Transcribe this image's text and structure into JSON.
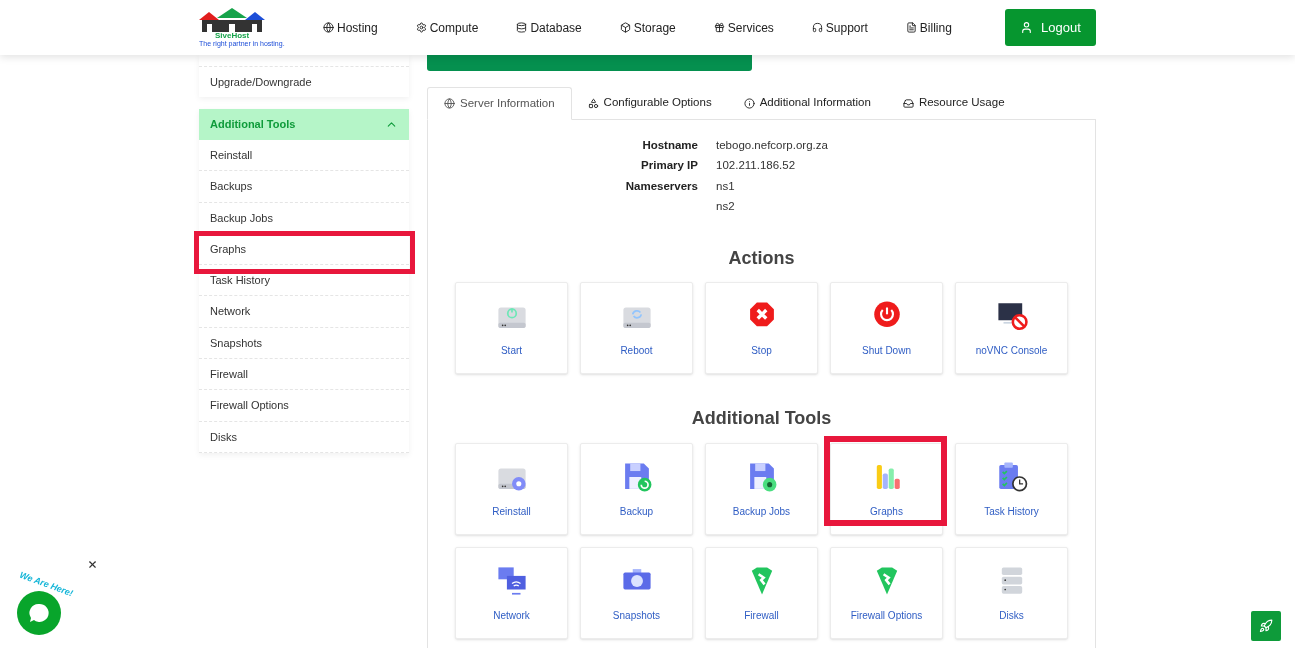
{
  "logo": {
    "name": "SiveHost",
    "tagline": "The right partner in hosting."
  },
  "nav": [
    {
      "label": "Hosting"
    },
    {
      "label": "Compute"
    },
    {
      "label": "Database"
    },
    {
      "label": "Storage"
    },
    {
      "label": "Services"
    },
    {
      "label": "Support"
    },
    {
      "label": "Billing"
    }
  ],
  "logout": "Logout",
  "sidebar": {
    "top_items": [
      {
        "label": "Upgrade/Downgrade"
      }
    ],
    "section": {
      "title": "Additional Tools",
      "expanded": true,
      "items": [
        {
          "label": "Reinstall",
          "highlighted": false
        },
        {
          "label": "Backups",
          "highlighted": false
        },
        {
          "label": "Backup Jobs",
          "highlighted": false
        },
        {
          "label": "Graphs",
          "highlighted": true
        },
        {
          "label": "Task History",
          "highlighted": false
        },
        {
          "label": "Network",
          "highlighted": false
        },
        {
          "label": "Snapshots",
          "highlighted": false
        },
        {
          "label": "Firewall",
          "highlighted": false
        },
        {
          "label": "Firewall Options",
          "highlighted": false
        },
        {
          "label": "Disks",
          "highlighted": false
        }
      ]
    }
  },
  "tabs": [
    {
      "label": "Server Information",
      "selected": true
    },
    {
      "label": "Configurable Options",
      "selected": false
    },
    {
      "label": "Additional Information",
      "selected": false
    },
    {
      "label": "Resource Usage",
      "selected": false
    }
  ],
  "server_info": [
    {
      "label": "Hostname",
      "values": [
        "tebogo.nefcorp.org.za"
      ]
    },
    {
      "label": "Primary IP",
      "values": [
        "102.211.186.52"
      ]
    },
    {
      "label": "Nameservers",
      "values": [
        "ns1",
        "ns2"
      ]
    }
  ],
  "actions": {
    "title": "Actions",
    "tiles": [
      {
        "label": "Start",
        "highlighted": false
      },
      {
        "label": "Reboot",
        "highlighted": false
      },
      {
        "label": "Stop",
        "highlighted": false
      },
      {
        "label": "Shut Down",
        "highlighted": false
      },
      {
        "label": "noVNC Console",
        "highlighted": false
      }
    ]
  },
  "additional_tools": {
    "title": "Additional Tools",
    "tiles": [
      {
        "label": "Reinstall",
        "highlighted": false
      },
      {
        "label": "Backup",
        "highlighted": false
      },
      {
        "label": "Backup Jobs",
        "highlighted": false
      },
      {
        "label": "Graphs",
        "highlighted": true
      },
      {
        "label": "Task History",
        "highlighted": false
      },
      {
        "label": "Network",
        "highlighted": false
      },
      {
        "label": "Snapshots",
        "highlighted": false
      },
      {
        "label": "Firewall",
        "highlighted": false
      },
      {
        "label": "Firewall Options",
        "highlighted": false
      },
      {
        "label": "Disks",
        "highlighted": false
      }
    ]
  },
  "chat_widget": {
    "caption": "We Are Here!"
  }
}
